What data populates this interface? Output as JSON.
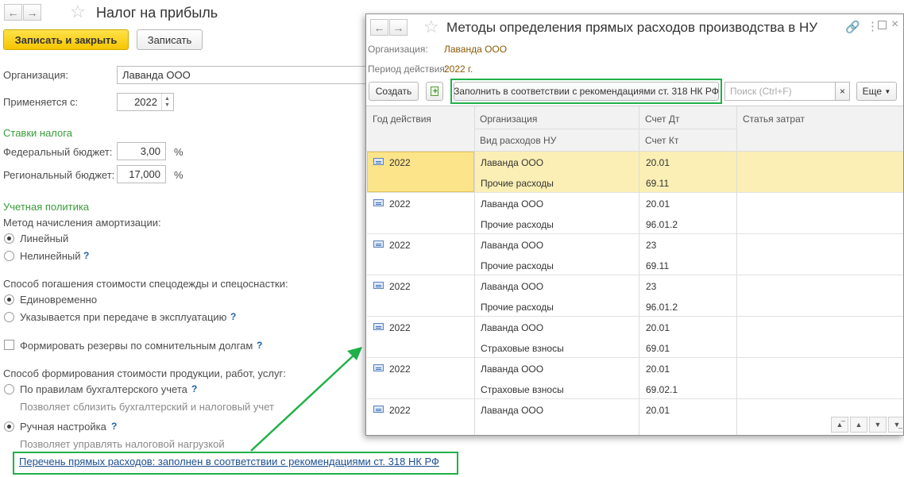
{
  "main": {
    "title": "Налог на прибыль",
    "save_close": "Записать и закрыть",
    "save": "Записать",
    "org_label": "Организация:",
    "org_value": "Лаванда ООО",
    "applies_label": "Применяется с:",
    "applies_value": "2022",
    "rates_section": "Ставки налога",
    "federal_label": "Федеральный бюджет:",
    "federal_value": "3,00",
    "regional_label": "Региональный бюджет:",
    "regional_value": "17,000",
    "percent": "%",
    "policy_section": "Учетная политика",
    "amort_label": "Метод начисления амортизации:",
    "amort_linear": "Линейный",
    "amort_nonlinear": "Нелинейный",
    "workwear_label": "Способ погашения стоимости спецодежды и спецоснастки:",
    "workwear_once": "Единовременно",
    "workwear_transfer": "Указывается при передаче в эксплуатацию",
    "reserves": "Формировать резервы по сомнительным долгам",
    "cost_label": "Способ формирования стоимости продукции, работ, услуг:",
    "cost_accounting": "По правилам бухгалтерского учета",
    "cost_accounting_hint": "Позволяет сблизить бухгалтерский и налоговый учет",
    "cost_manual": "Ручная настройка",
    "cost_manual_hint": "Позволяет управлять налоговой нагрузкой",
    "direct_link": "Перечень прямых расходов: заполнен в соответствии с рекомендациями ст. 318 НК РФ",
    "help": "?"
  },
  "sub": {
    "title": "Методы определения прямых расходов производства в НУ",
    "org_label": "Организация:",
    "org_value": "Лаванда ООО",
    "period_label": "Период действия:",
    "period_value": "2022 г.",
    "create": "Создать",
    "fill": "Заполнить в соответствии с рекомендациями ст. 318 НК РФ",
    "search_placeholder": "Поиск (Ctrl+F)",
    "more": "Еще",
    "columns": {
      "year": "Год действия",
      "org": "Организация",
      "expense_type": "Вид расходов НУ",
      "debit": "Счет Дт",
      "credit": "Счет Кт",
      "cost_item": "Статья затрат"
    },
    "rows": [
      {
        "year": "2022",
        "org": "Лаванда ООО",
        "type": "Прочие расходы",
        "dt": "20.01",
        "kt": "69.11"
      },
      {
        "year": "2022",
        "org": "Лаванда ООО",
        "type": "Прочие расходы",
        "dt": "20.01",
        "kt": "96.01.2"
      },
      {
        "year": "2022",
        "org": "Лаванда ООО",
        "type": "Прочие расходы",
        "dt": "23",
        "kt": "69.11"
      },
      {
        "year": "2022",
        "org": "Лаванда ООО",
        "type": "Прочие расходы",
        "dt": "23",
        "kt": "96.01.2"
      },
      {
        "year": "2022",
        "org": "Лаванда ООО",
        "type": "Страховые взносы",
        "dt": "20.01",
        "kt": "69.01"
      },
      {
        "year": "2022",
        "org": "Лаванда ООО",
        "type": "Страховые взносы",
        "dt": "20.01",
        "kt": "69.02.1"
      },
      {
        "year": "2022",
        "org": "Лаванда ООО",
        "type": "",
        "dt": "20.01",
        "kt": ""
      }
    ]
  }
}
